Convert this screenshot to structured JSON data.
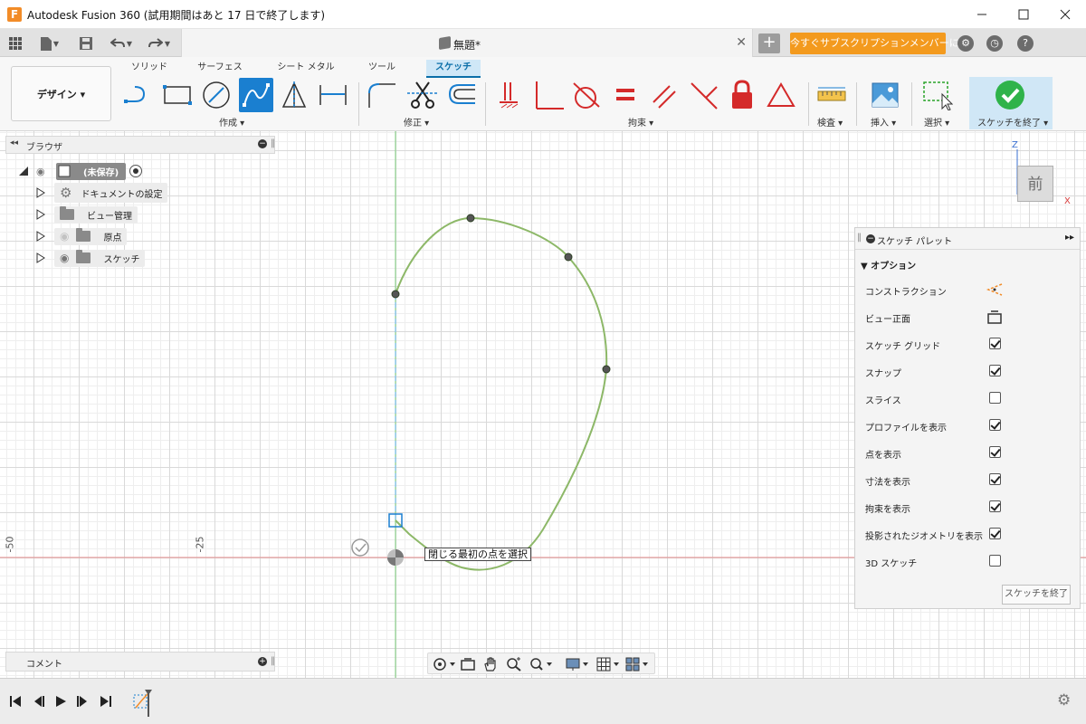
{
  "window": {
    "logo_letter": "F",
    "title": "Autodesk Fusion 360 (試用期間はあと 17 日で終了します)"
  },
  "quick_access": {
    "document_tab": "無題*",
    "subscribe_label": "今すぐサブスクリプションメンバーに..."
  },
  "ribbon": {
    "workspace": "デザイン ▾",
    "tabs": [
      "ソリッド",
      "サーフェス",
      "シート メタル",
      "ツール",
      "スケッチ"
    ],
    "groups": [
      "作成 ▾",
      "修正 ▾",
      "拘束 ▾",
      "検査 ▾",
      "挿入 ▾",
      "選択 ▾",
      "スケッチを終了 ▾"
    ]
  },
  "browser": {
    "title": "ブラウザ",
    "root_label": "(未保存)",
    "items": [
      "ドキュメントの設定",
      "ビュー管理",
      "原点",
      "スケッチ"
    ]
  },
  "comments": {
    "label": "コメント"
  },
  "viewcube": {
    "face": "前",
    "axis_z": "Z",
    "axis_x": "X"
  },
  "canvas": {
    "ruler_labels": [
      "-50",
      "-25"
    ],
    "tooltip": "閉じる最初の点を選択"
  },
  "sketch_palette": {
    "title": "スケッチ パレット",
    "section": "オプション",
    "options": [
      {
        "label": "コンストラクション",
        "type": "icon"
      },
      {
        "label": "ビュー正面",
        "type": "icon"
      },
      {
        "label": "スケッチ グリッド",
        "checked": true
      },
      {
        "label": "スナップ",
        "checked": true
      },
      {
        "label": "スライス",
        "checked": false
      },
      {
        "label": "プロファイルを表示",
        "checked": true
      },
      {
        "label": "点を表示",
        "checked": true
      },
      {
        "label": "寸法を表示",
        "checked": true
      },
      {
        "label": "拘束を表示",
        "checked": true
      },
      {
        "label": "投影されたジオメトリを表示",
        "checked": true
      },
      {
        "label": "3D スケッチ",
        "checked": false
      }
    ],
    "finish_button": "スケッチを終了"
  },
  "colors": {
    "accent": "#1a7fd0",
    "subscribe": "#f39a1e",
    "spline": "#8db868",
    "constraint_red": "#d42a2a"
  }
}
